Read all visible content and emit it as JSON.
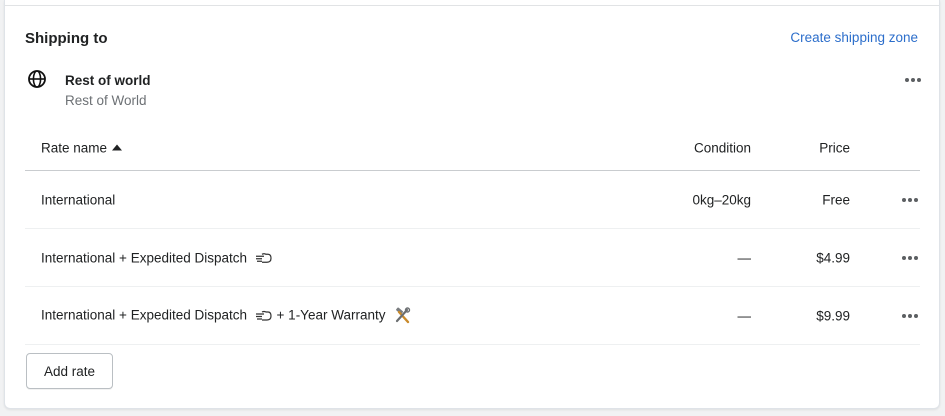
{
  "section": {
    "title": "Shipping to",
    "create_link": "Create shipping zone"
  },
  "zone": {
    "icon": "globe-icon",
    "name": "Rest of world",
    "subtitle": "Rest of World"
  },
  "table": {
    "headers": {
      "rate_name": "Rate name",
      "condition": "Condition",
      "price": "Price"
    },
    "rows": [
      {
        "name": "International",
        "condition": "0kg–20kg",
        "price": "Free",
        "emojis": []
      },
      {
        "name": "International + Expedited Dispatch",
        "condition": "—",
        "price": "$4.99",
        "emojis": [
          "pointing-hand-icon"
        ]
      },
      {
        "name": "International + Expedited Dispatch",
        "name_suffix": "+ 1-Year Warranty",
        "condition": "—",
        "price": "$9.99",
        "emojis": [
          "pointing-hand-icon",
          "hammer-wrench-icon"
        ]
      }
    ]
  },
  "add_rate_label": "Add rate",
  "colors": {
    "link": "#2c6ecb",
    "text": "#202223",
    "subdued": "#6d7175"
  }
}
